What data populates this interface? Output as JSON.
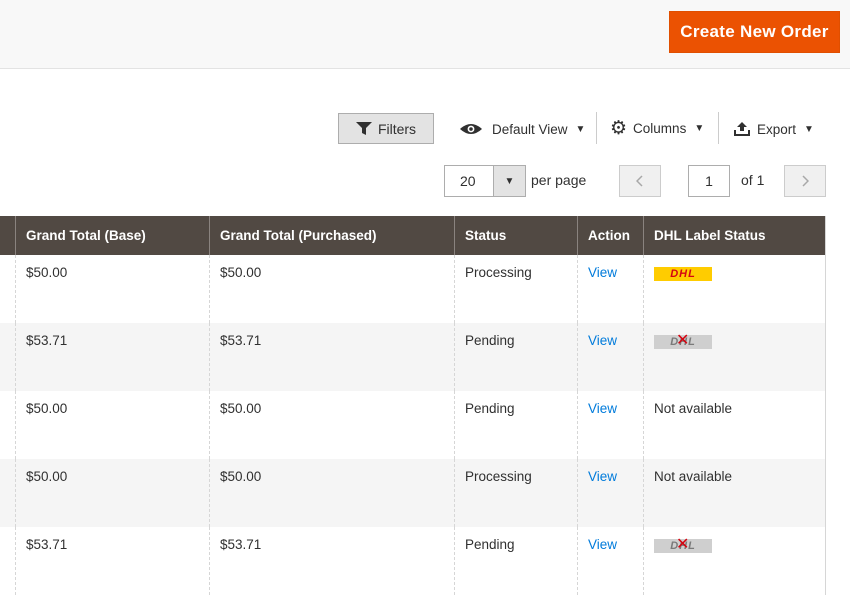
{
  "header": {
    "create_label": "Create New Order"
  },
  "toolbar": {
    "filters_label": "Filters",
    "view_label": "Default View",
    "columns_label": "Columns",
    "export_label": "Export"
  },
  "pagination": {
    "per_page_value": "20",
    "per_page_label": "per page",
    "current_page": "1",
    "of_label": "of 1"
  },
  "table": {
    "columns": [
      "Grand Total (Base)",
      "Grand Total (Purchased)",
      "Status",
      "Action",
      "DHL Label Status"
    ],
    "rows": [
      {
        "base": "$50.00",
        "purchased": "$50.00",
        "status": "Processing",
        "action": "View",
        "dhl": "",
        "dhl_logo": "dhl-available-logo"
      },
      {
        "base": "$53.71",
        "purchased": "$53.71",
        "status": "Pending",
        "action": "View",
        "dhl": "",
        "dhl_logo": "dhl-unavailable-logo"
      },
      {
        "base": "$50.00",
        "purchased": "$50.00",
        "status": "Pending",
        "action": "View",
        "dhl": "Not available",
        "dhl_logo": ""
      },
      {
        "base": "$50.00",
        "purchased": "$50.00",
        "status": "Processing",
        "action": "View",
        "dhl": "Not available",
        "dhl_logo": ""
      },
      {
        "base": "$53.71",
        "purchased": "$53.71",
        "status": "Pending",
        "action": "View",
        "dhl": "",
        "dhl_logo": "dhl-unavailable-logo"
      }
    ]
  },
  "colors": {
    "accent": "#eb5202",
    "header_bg": "#514943",
    "link": "#007bdb"
  },
  "icons": {
    "filter": "filter-icon",
    "eye": "eye-icon",
    "gear": "gear-icon",
    "export": "export-icon"
  }
}
